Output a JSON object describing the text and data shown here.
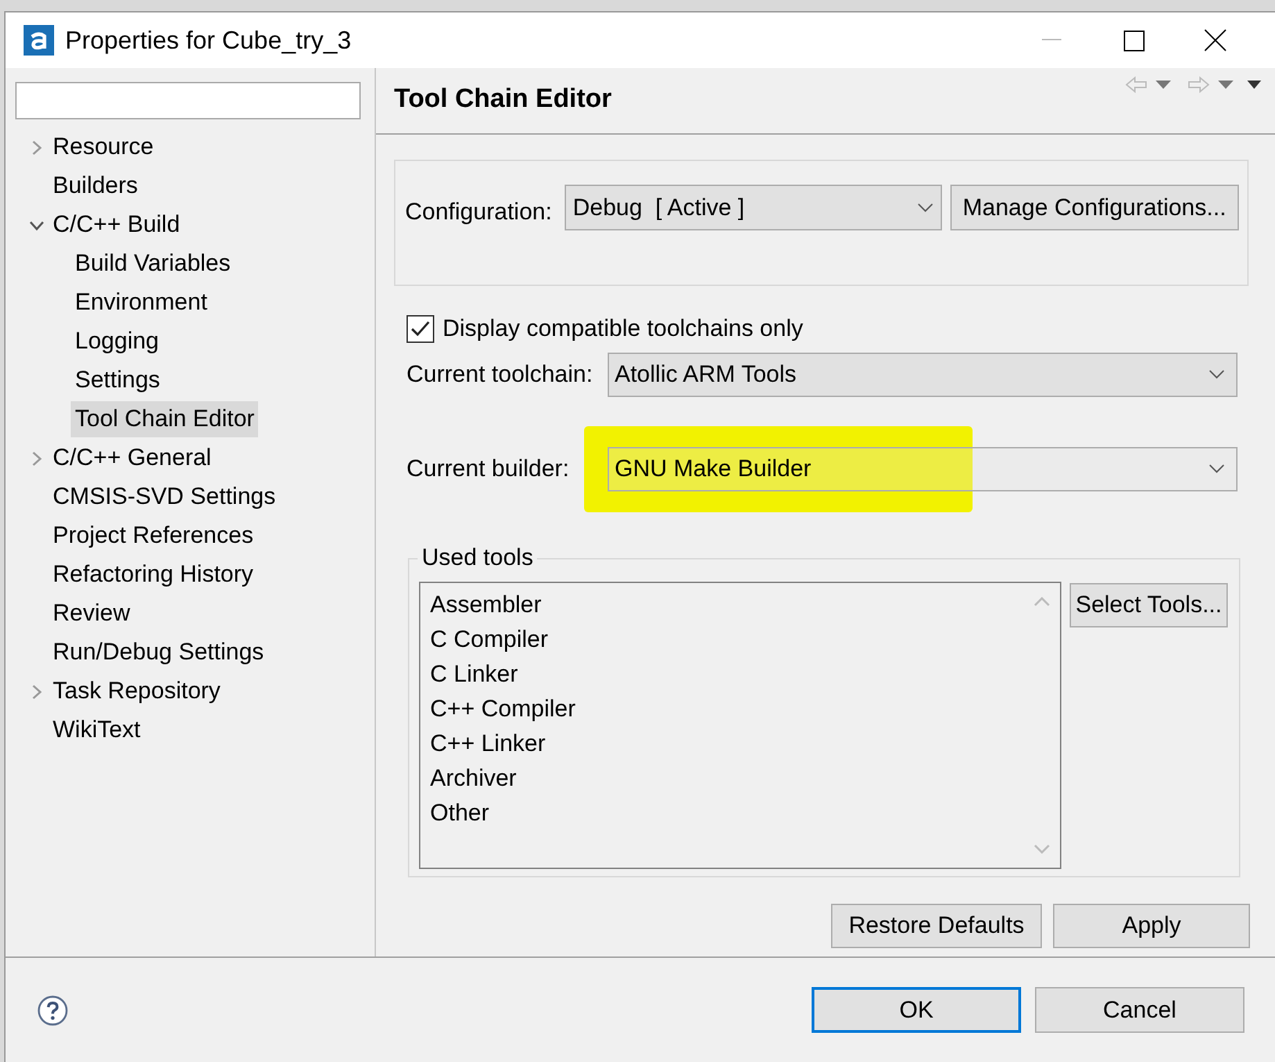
{
  "window": {
    "title": "Properties for Cube_try_3"
  },
  "sidebar": {
    "items": [
      {
        "label": "Resource",
        "expanded": false,
        "selected": false
      },
      {
        "label": "Builders",
        "selected": false
      },
      {
        "label": "C/C++ Build",
        "expanded": true,
        "selected": false,
        "children": [
          {
            "label": "Build Variables",
            "selected": false
          },
          {
            "label": "Environment",
            "selected": false
          },
          {
            "label": "Logging",
            "selected": false
          },
          {
            "label": "Settings",
            "selected": false
          },
          {
            "label": "Tool Chain Editor",
            "selected": true
          }
        ]
      },
      {
        "label": "C/C++ General",
        "expanded": false,
        "selected": false
      },
      {
        "label": "CMSIS-SVD Settings",
        "selected": false
      },
      {
        "label": "Project References",
        "selected": false
      },
      {
        "label": "Refactoring History",
        "selected": false
      },
      {
        "label": "Review",
        "selected": false
      },
      {
        "label": "Run/Debug Settings",
        "selected": false
      },
      {
        "label": "Task Repository",
        "expanded": false,
        "selected": false
      },
      {
        "label": "WikiText",
        "selected": false
      }
    ]
  },
  "page": {
    "title": "Tool Chain Editor",
    "configuration": {
      "label": "Configuration:",
      "value": "Debug  [ Active ]",
      "button": "Manage Configurations..."
    },
    "compatible_only": {
      "label": "Display compatible toolchains only",
      "checked": true
    },
    "toolchain": {
      "label": "Current toolchain:",
      "value": "Atollic ARM Tools"
    },
    "builder": {
      "label": "Current builder:",
      "value": "GNU Make Builder",
      "highlighted": true
    },
    "used_tools": {
      "title": "Used tools",
      "items": [
        "Assembler",
        "C Compiler",
        "C Linker",
        "C++ Compiler",
        "C++ Linker",
        "Archiver",
        "Other"
      ],
      "button": "Select Tools..."
    },
    "buttons": [
      "Restore Defaults",
      "Apply"
    ]
  },
  "footer": {
    "buttons": [
      {
        "label": "OK",
        "default": true
      },
      {
        "label": "Cancel",
        "default": false
      }
    ]
  }
}
